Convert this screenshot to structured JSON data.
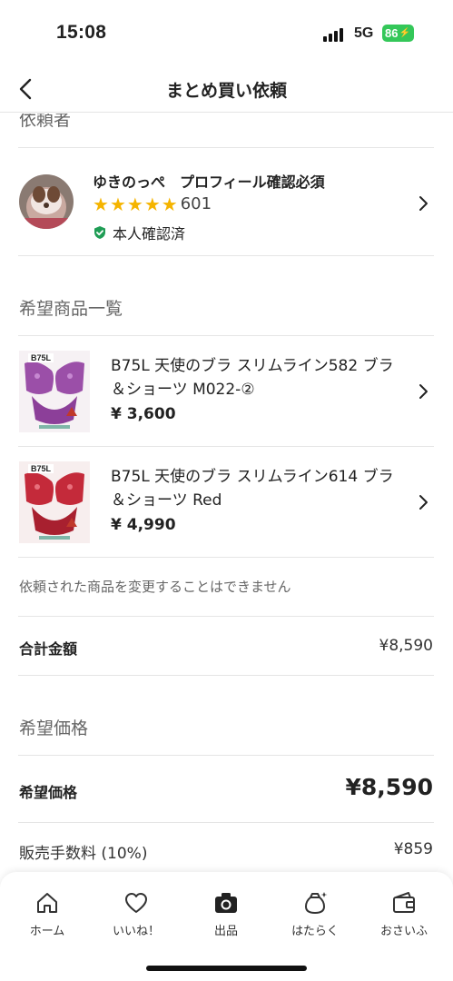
{
  "status_bar": {
    "time": "15:08",
    "network": "5G",
    "battery": "86"
  },
  "nav": {
    "title": "まとめ買い依頼"
  },
  "sections": {
    "requester": "依頼者",
    "items": "希望商品一覧",
    "desired_price": "希望価格"
  },
  "seller": {
    "name": "ゆきのっぺ　プロフィール確認必須",
    "rating_stars": 5,
    "review_count": "601",
    "verified_label": "本人確認済"
  },
  "items": [
    {
      "title": "B75L 天使のブラ スリムライン582 ブラ＆ショーツ M022-②",
      "price": "¥ 3,600",
      "thumb_label": "B75L",
      "thumb_color": "#9b4fa8"
    },
    {
      "title": "B75L 天使のブラ スリムライン614 ブラ＆ショーツ Red",
      "price": "¥ 4,990",
      "thumb_label": "B75L",
      "thumb_color": "#c42a3a"
    }
  ],
  "note": "依頼された商品を変更することはできません",
  "total": {
    "label": "合計金額",
    "value": "¥8,590"
  },
  "desired": {
    "label": "希望価格",
    "value": "¥8,590"
  },
  "fee": {
    "label": "販売手数料 (10%)",
    "value": "¥859"
  },
  "tabs": [
    {
      "label": "ホーム",
      "icon": "home-icon"
    },
    {
      "label": "いいね！",
      "icon": "heart-icon"
    },
    {
      "label": "出品",
      "icon": "camera-icon"
    },
    {
      "label": "はたらく",
      "icon": "bag-sparkle-icon"
    },
    {
      "label": "おさいふ",
      "icon": "wallet-icon"
    }
  ],
  "colors": {
    "star": "#f5b400",
    "verified": "#1f9d55",
    "battery": "#34c759"
  }
}
